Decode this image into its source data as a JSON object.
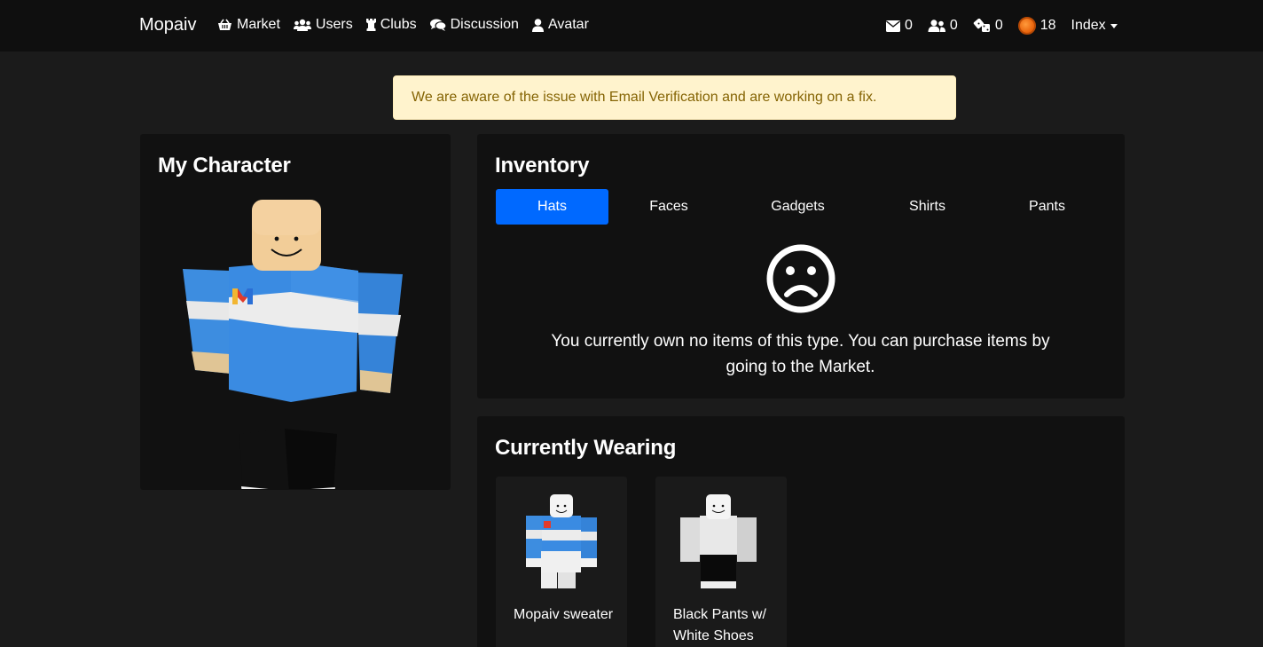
{
  "nav": {
    "brand": "Mopaiv",
    "links": [
      {
        "label": "Market",
        "icon": "basket-icon"
      },
      {
        "label": "Users",
        "icon": "users-icon"
      },
      {
        "label": "Clubs",
        "icon": "chess-rook-icon"
      },
      {
        "label": "Discussion",
        "icon": "comments-icon"
      },
      {
        "label": "Avatar",
        "icon": "user-icon"
      }
    ],
    "stats": {
      "messages": "0",
      "friend_requests": "0",
      "trades": "0",
      "currency": "18"
    },
    "dropdown_label": "Index"
  },
  "alert": {
    "text": "We are aware of the issue with Email Verification and are working on a fix."
  },
  "character": {
    "title": "My Character"
  },
  "inventory": {
    "title": "Inventory",
    "tabs": [
      "Hats",
      "Faces",
      "Gadgets",
      "Shirts",
      "Pants"
    ],
    "active_tab": "Hats",
    "empty_message": "You currently own no items of this type. You can purchase items by going to the Market."
  },
  "wearing": {
    "title": "Currently Wearing",
    "items": [
      {
        "name": "Mopaiv sweater"
      },
      {
        "name": "Black Pants w/ White Shoes"
      }
    ]
  },
  "colors": {
    "accent": "#0069ff",
    "alert_bg": "#fff3cd",
    "alert_text": "#856404",
    "card_bg": "#111111",
    "page_bg": "#1b1b1b"
  }
}
